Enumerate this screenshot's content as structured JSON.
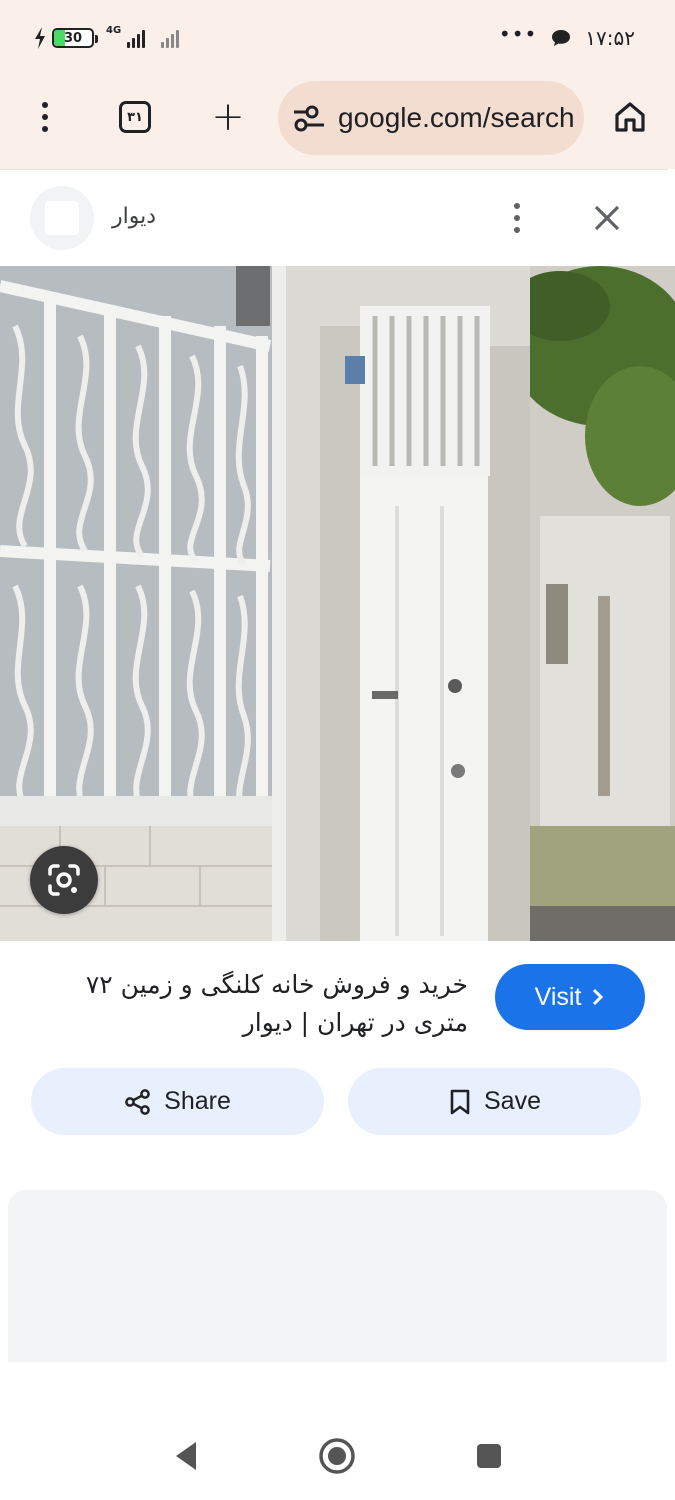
{
  "status_bar": {
    "battery": "30",
    "battery_level": 0.3,
    "network": "4G",
    "time": "۱۷:۵۲",
    "more": "•••"
  },
  "browser": {
    "tab_count": "۳۱",
    "new_tab": "+",
    "url": "google.com/search"
  },
  "card": {
    "source_name": "دیوار",
    "title": "خرید و فروش خانه کلنگی و زمین ۷۲ متری در تهران | دیوار",
    "visit_label": "Visit",
    "share_label": "Share",
    "save_label": "Save"
  },
  "colors": {
    "accent": "#1a73e8",
    "chip_bg": "#e8f0fe",
    "browser_bg": "#fbf0e9",
    "url_bg": "#f3dcd0"
  },
  "icons": {
    "menu": "kebab-icon",
    "tabs": "tab-switcher-icon",
    "home": "home-icon",
    "site_settings": "tune-icon",
    "close": "close-icon",
    "lens": "lens-icon",
    "share": "share-icon",
    "save": "bookmark-icon",
    "back": "back-triangle-icon",
    "home_nav": "home-circle-icon",
    "recents": "recents-square-icon"
  }
}
